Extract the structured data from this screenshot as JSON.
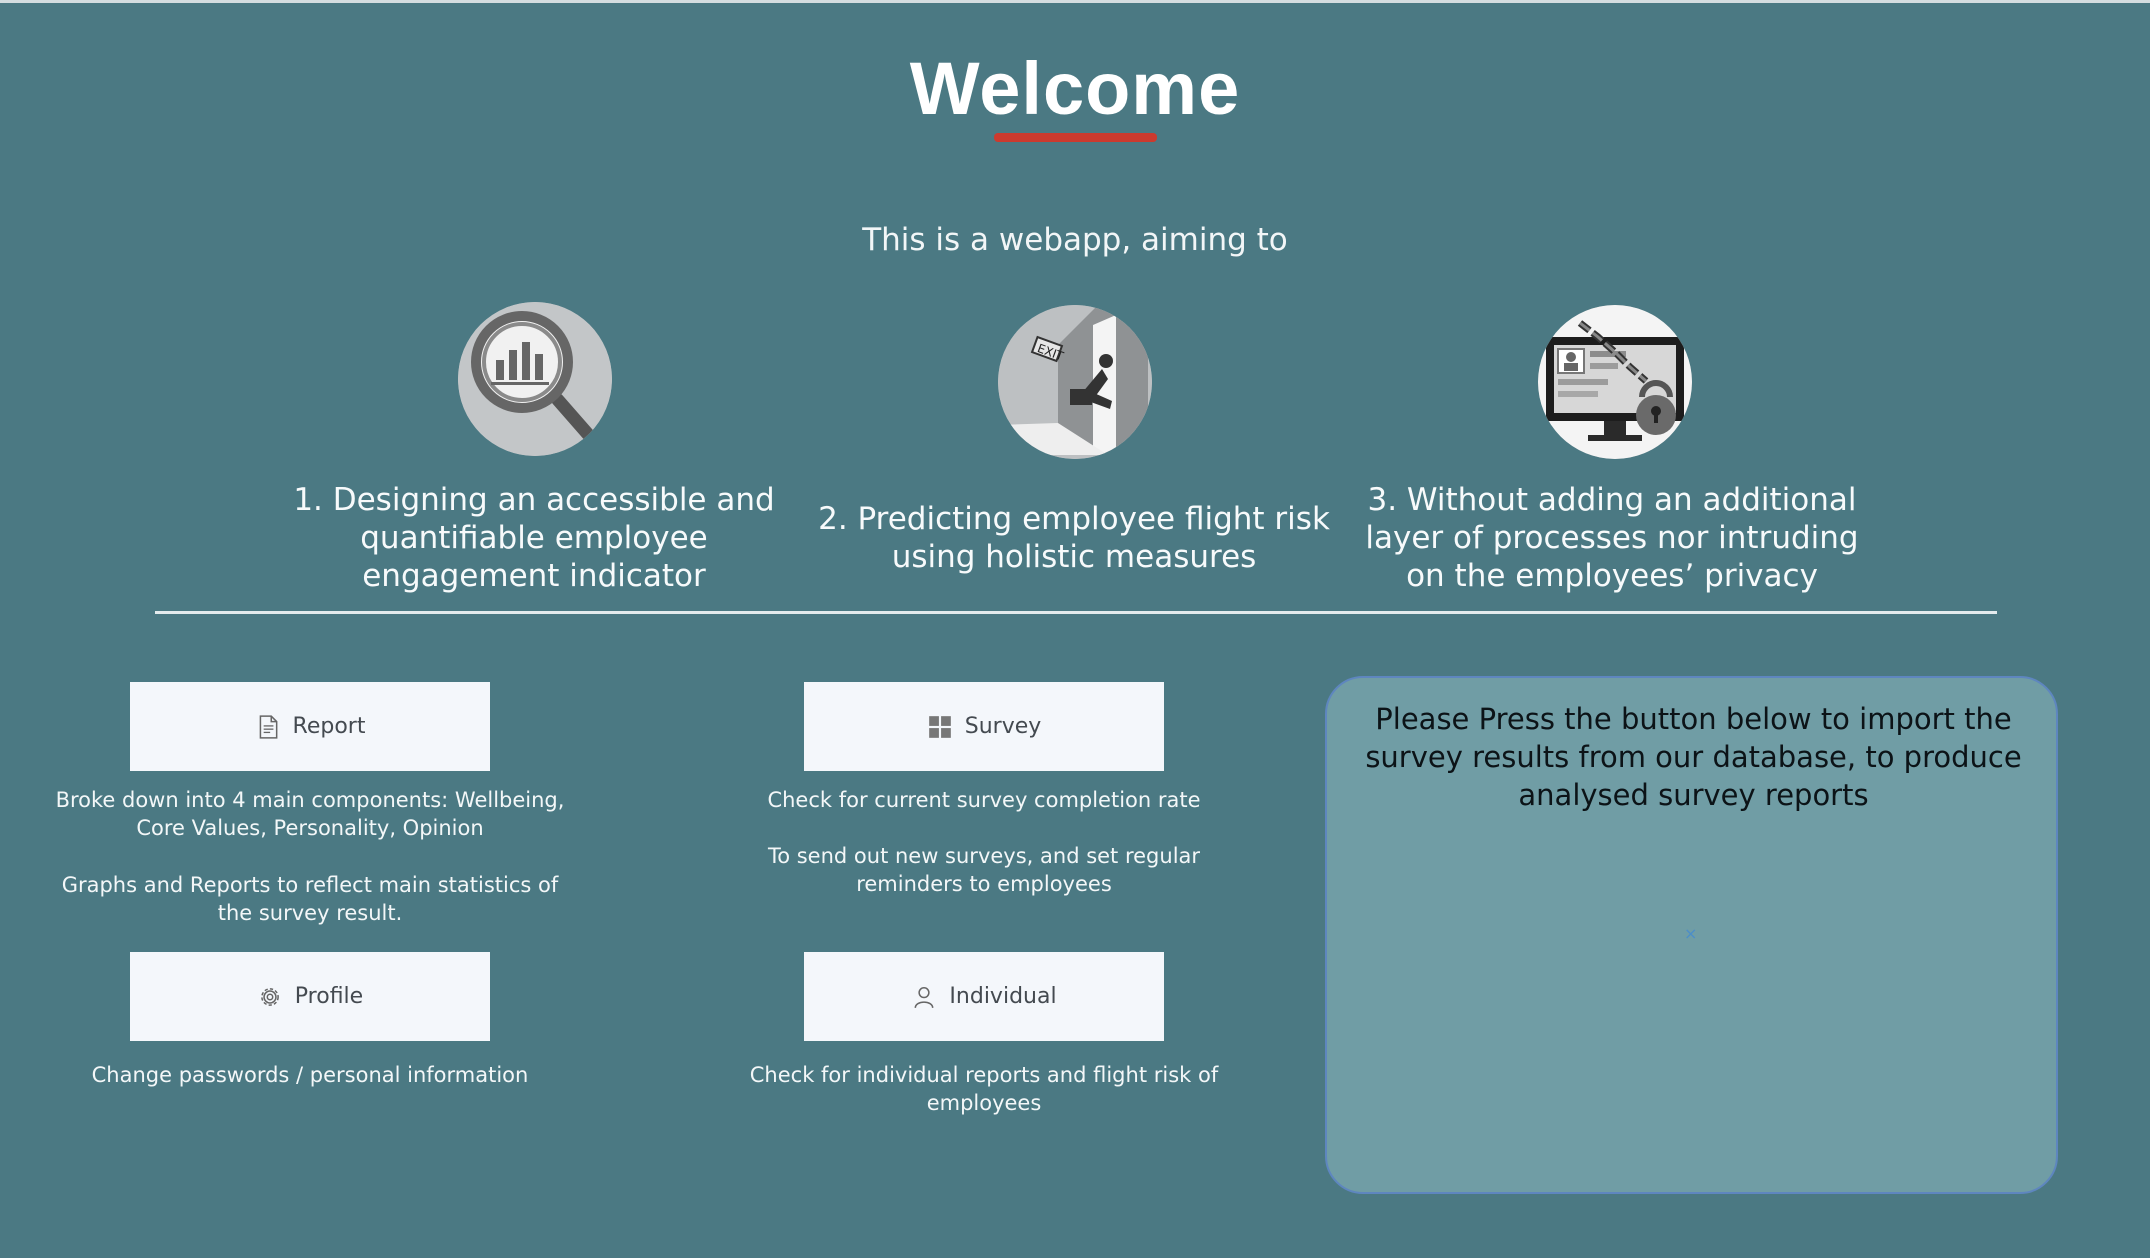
{
  "header": {
    "title": "Welcome",
    "subtitle": "This is a webapp, aiming to"
  },
  "goals": [
    {
      "icon": "magnifier-chart-icon",
      "text": "1. Designing an accessible and quantifiable employee engagement indicator"
    },
    {
      "icon": "exit-door-icon",
      "text": "2. Predicting employee flight risk using holistic measures"
    },
    {
      "icon": "locked-monitor-icon",
      "text": "3. Without adding an additional layer of processes nor intruding on the employees’ privacy"
    }
  ],
  "nav": {
    "report": {
      "label": "Report",
      "icon": "document-icon",
      "desc1": "Broke down into 4 main components: Wellbeing, Core Values, Personality, Opinion",
      "desc2": "Graphs and Reports to reflect main  statistics of the survey result."
    },
    "survey": {
      "label": "Survey",
      "icon": "grid-icon",
      "desc1": "Check for current survey completion rate",
      "desc2": "To send out new surveys, and set regular reminders to employees"
    },
    "profile": {
      "label": "Profile",
      "icon": "gear-icon",
      "desc": "Change passwords / personal information"
    },
    "individual": {
      "label": "Individual",
      "icon": "person-icon",
      "desc": "Check for individual reports and flight risk of employees"
    }
  },
  "import_panel": {
    "text": "Please Press the button below to import the survey results from our database, to produce analysed survey reports",
    "placeholder_glyph": "×"
  },
  "colors": {
    "background": "#4b7983",
    "accent": "#cc3a2e",
    "panel": "#709da5",
    "button": "#f4f7fb"
  }
}
